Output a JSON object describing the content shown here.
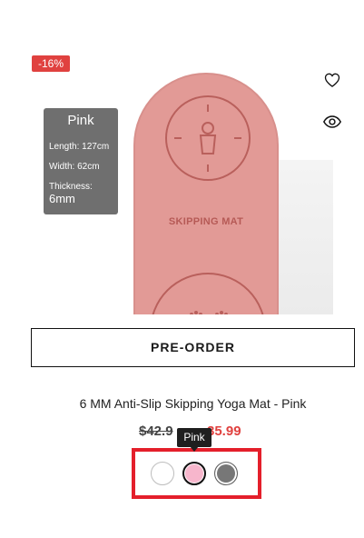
{
  "product": {
    "badge": "-16%",
    "title": "6 MM Anti-Slip Skipping Yoga Mat - Pink",
    "old_price": "$42.9",
    "new_price": "35.99",
    "preorder_label": "PRE-ORDER"
  },
  "image": {
    "mat_label": "SKIPPING MAT",
    "spec_title": "Pink",
    "spec_length": "Length: 127cm",
    "spec_width": "Width: 62cm",
    "spec_thickness_label": "Thickness: ",
    "spec_thickness_value": "6mm"
  },
  "swatches": {
    "tooltip": "Pink",
    "options": [
      {
        "name": "White",
        "color": "#ffffff"
      },
      {
        "name": "Pink",
        "color": "#f7b6cc"
      },
      {
        "name": "Gray",
        "color": "#777777"
      }
    ],
    "highlight_color": "#e41f2b"
  },
  "icons": {
    "wishlist": "heart-icon",
    "quickview": "eye-icon"
  },
  "colors": {
    "accent": "#e0413f",
    "text": "#1a1a1a"
  }
}
